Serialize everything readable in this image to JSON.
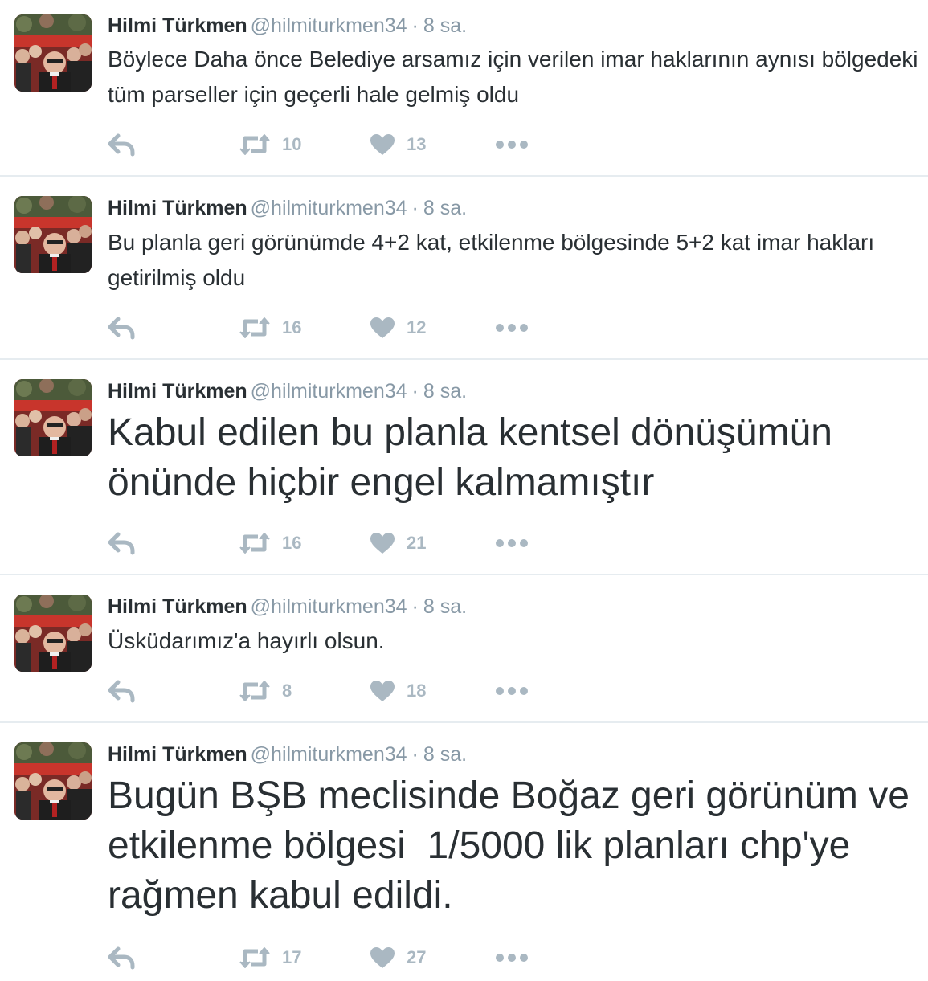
{
  "tweets": [
    {
      "name": "Hilmi Türkmen",
      "handle": "@hilmiturkmen34",
      "sep": "·",
      "time": "8 sa.",
      "text": "Böylece Daha önce Belediye arsamız için verilen imar haklarının aynısı bölgedeki tüm parseller için geçerli hale gelmiş oldu",
      "retweets": "10",
      "likes": "13"
    },
    {
      "name": "Hilmi Türkmen",
      "handle": "@hilmiturkmen34",
      "sep": "·",
      "time": "8 sa.",
      "text": "Bu planla geri görünümde 4+2 kat, etkilenme bölgesinde 5+2 kat imar hakları getirilmiş oldu",
      "retweets": "16",
      "likes": "12"
    },
    {
      "name": "Hilmi Türkmen",
      "handle": "@hilmiturkmen34",
      "sep": "·",
      "time": "8 sa.",
      "text": "Kabul edilen bu planla kentsel dönüşümün önünde hiçbir engel kalmamıştır",
      "retweets": "16",
      "likes": "21"
    },
    {
      "name": "Hilmi Türkmen",
      "handle": "@hilmiturkmen34",
      "sep": "·",
      "time": "8 sa.",
      "text": "Üsküdarımız'a hayırlı olsun.",
      "retweets": "8",
      "likes": "18"
    },
    {
      "name": "Hilmi Türkmen",
      "handle": "@hilmiturkmen34",
      "sep": "·",
      "time": "8 sa.",
      "text": "Bugün BŞB meclisinde Boğaz geri görünüm ve etkilenme bölgesi  1/5000 lik planları chp'ye rağmen kabul edildi.",
      "retweets": "17",
      "likes": "27"
    }
  ],
  "colors": {
    "text": "#292f33",
    "muted": "#8899a6",
    "icon": "#aab8c2",
    "divider": "#e6ecf0"
  },
  "icons": {
    "reply": "reply-icon",
    "retweet": "retweet-icon",
    "like": "heart-icon",
    "more": "more-dots-icon"
  }
}
